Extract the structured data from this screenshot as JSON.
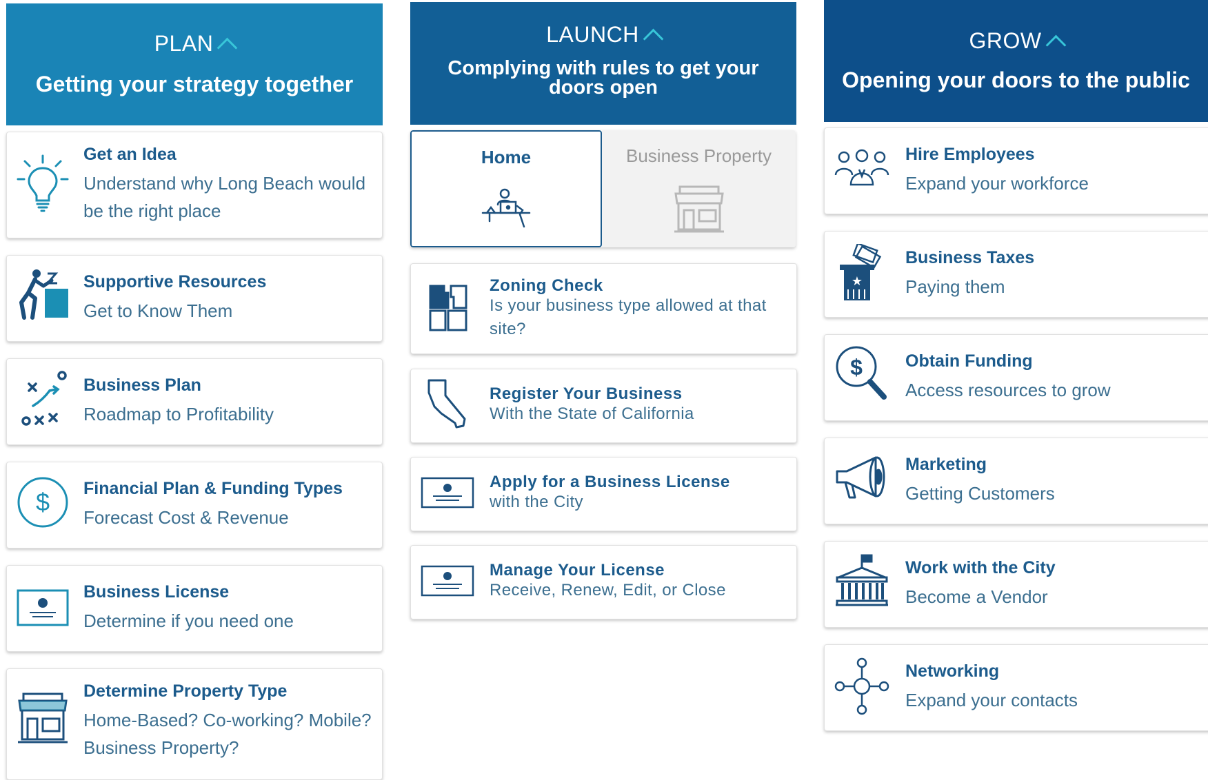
{
  "plan": {
    "phase": "PLAN",
    "subtitle": "Getting your strategy together",
    "items": [
      {
        "title": "Get an Idea",
        "desc": "Understand why Long Beach would be the right place",
        "icon": "lightbulb-icon"
      },
      {
        "title": "Supportive Resources",
        "desc": "Get to Know Them",
        "icon": "climbing-person-icon"
      },
      {
        "title": "Business Plan",
        "desc": "Roadmap to Profitability",
        "icon": "strategy-play-icon"
      },
      {
        "title": "Financial Plan & Funding Types",
        "desc": "Forecast Cost & Revenue",
        "icon": "dollar-circle-icon"
      },
      {
        "title": "Business License",
        "desc": "Determine if you need one",
        "icon": "license-certificate-icon"
      },
      {
        "title": "Determine Property Type",
        "desc": "Home-Based? Co-working? Mobile? Business Property?",
        "icon": "storefront-icon"
      }
    ]
  },
  "launch": {
    "phase": "LAUNCH",
    "subtitle": "Complying with rules to get your doors open",
    "tabs": [
      {
        "label": "Home",
        "active": true,
        "icon": "home-desk-icon"
      },
      {
        "label": "Business Property",
        "active": false,
        "icon": "storefront-icon"
      }
    ],
    "items": [
      {
        "title": "Zoning Check",
        "desc": "Is your business type allowed at that site?",
        "icon": "zoning-map-icon"
      },
      {
        "title": "Register Your Business",
        "desc": "With the State of California",
        "icon": "california-map-icon"
      },
      {
        "title": "Apply for a Business License",
        "desc": "with the City",
        "icon": "license-certificate-icon"
      },
      {
        "title": "Manage Your License",
        "desc": "Receive, Renew, Edit, or Close",
        "icon": "license-certificate-icon"
      }
    ]
  },
  "grow": {
    "phase": "GROW",
    "subtitle": "Opening your doors to the public",
    "items": [
      {
        "title": "Hire Employees",
        "desc": "Expand your workforce",
        "icon": "employees-group-icon"
      },
      {
        "title": "Business Taxes",
        "desc": "Paying them",
        "icon": "tax-money-icon"
      },
      {
        "title": "Obtain Funding",
        "desc": "Access resources to grow",
        "icon": "dollar-magnifier-icon"
      },
      {
        "title": "Marketing",
        "desc": "Getting Customers",
        "icon": "megaphone-icon"
      },
      {
        "title": "Work with the City",
        "desc": "Become a Vendor",
        "icon": "city-hall-icon"
      },
      {
        "title": "Networking",
        "desc": "Expand your contacts",
        "icon": "network-nodes-icon"
      }
    ]
  },
  "colors": {
    "plan_header": "#1a84b6",
    "launch_header": "#125f96",
    "grow_header": "#0d4f8a",
    "title_text": "#1c5b8c",
    "icon_plan": "#1b8fb4",
    "icon_dark": "#1c4f7c"
  }
}
